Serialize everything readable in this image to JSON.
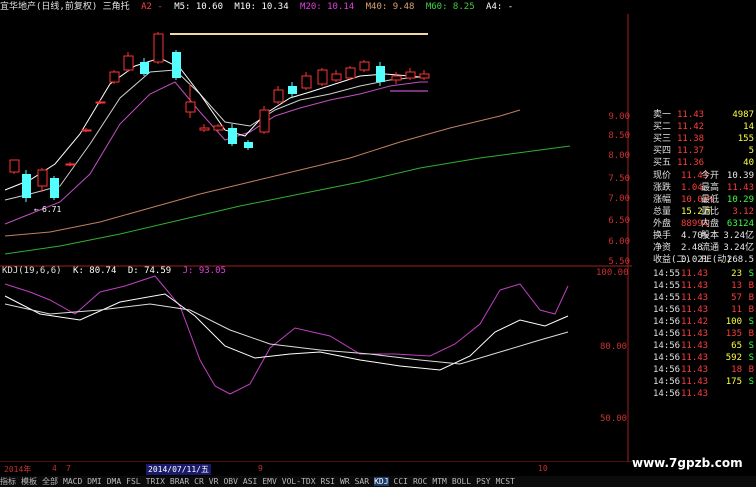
{
  "topbar": {
    "title": "宜华地产(日线,前复权) 三角托",
    "a2": "A2 -",
    "m5": "M5: 10.60",
    "m10": "M10: 10.34",
    "m20": "M20: 10.14",
    "m40": "M40: 9.48",
    "m60": "M60: 8.25",
    "a4": "A4: -"
  },
  "colors": {
    "bg": "#000000",
    "up": "#ff3232",
    "down": "#54ffff",
    "ma5": "#ffffff",
    "ma10": "#e0e0e0",
    "ma20": "#c050c0",
    "ma40": "#d08060",
    "ma60": "#30b030",
    "resist": "#f0d8a0",
    "price_red": "#ff3c3c",
    "price_green": "#3cff3c",
    "price_white": "#e8e8e8",
    "price_yellow": "#ffff40"
  },
  "price_axis": [
    "9.00",
    "8.50",
    "8.00",
    "7.50",
    "7.00",
    "6.50",
    "6.00",
    "5.50"
  ],
  "low_marker": "6.71",
  "kdj": {
    "title": "KDJ(19,6,6)",
    "k": "K: 80.74",
    "d": "D: 74.59",
    "j": "J: 93.05",
    "axis": [
      "100.00",
      "80.00",
      "50.00"
    ]
  },
  "date_axis": {
    "year": "2014年",
    "m4": "4",
    "m7": "7",
    "cursor_date": "2014/07/11/五",
    "m9": "9",
    "m10": "10"
  },
  "quote": {
    "asks": [
      {
        "label": "卖一",
        "price": "11.43",
        "vol": "4987"
      },
      {
        "label": "买二",
        "price": "11.42",
        "vol": "14"
      },
      {
        "label": "买三",
        "price": "11.38",
        "vol": "155"
      },
      {
        "label": "买四",
        "price": "11.37",
        "vol": "5"
      },
      {
        "label": "买五",
        "price": "11.36",
        "vol": "40"
      }
    ],
    "stats": [
      {
        "l1": "现价",
        "v1": "11.43",
        "l2": "今开",
        "v2": "10.39",
        "c1": "red",
        "c2": "white"
      },
      {
        "l1": "涨跌",
        "v1": "1.04",
        "l2": "最高",
        "v2": "11.43",
        "c1": "red",
        "c2": "red"
      },
      {
        "l1": "涨幅",
        "v1": "10.01%",
        "l2": "最低",
        "v2": "10.29",
        "c1": "red",
        "c2": "green"
      },
      {
        "l1": "总量",
        "v1": "15.2万",
        "l2": "量比",
        "v2": "3.12",
        "c1": "yellow",
        "c2": "red"
      },
      {
        "l1": "外盘",
        "v1": "88994",
        "l2": "内盘",
        "v2": "63124",
        "c1": "red",
        "c2": "green"
      },
      {
        "l1": "换手",
        "v1": "4.70%",
        "l2": "股本",
        "v2": "3.24亿",
        "c1": "white",
        "c2": "white"
      },
      {
        "l1": "净资",
        "v1": "2.48",
        "l2": "流通",
        "v2": "3.24亿",
        "c1": "white",
        "c2": "white"
      },
      {
        "l1": "收益(二)",
        "v1": "0.021",
        "l2": "PE(动)",
        "v2": "268.5",
        "c1": "white",
        "c2": "white"
      }
    ],
    "ticks": [
      {
        "time": "14:55",
        "price": "11.43",
        "vol": "23",
        "side": "S"
      },
      {
        "time": "14:55",
        "price": "11.43",
        "vol": "13",
        "side": "B"
      },
      {
        "time": "14:55",
        "price": "11.43",
        "vol": "57",
        "side": "B"
      },
      {
        "time": "14:56",
        "price": "11.43",
        "vol": "11",
        "side": "B"
      },
      {
        "time": "14:56",
        "price": "11.42",
        "vol": "100",
        "side": "S"
      },
      {
        "time": "14:56",
        "price": "11.43",
        "vol": "135",
        "side": "B"
      },
      {
        "time": "14:56",
        "price": "11.43",
        "vol": "65",
        "side": "S"
      },
      {
        "time": "14:56",
        "price": "11.43",
        "vol": "592",
        "side": "S"
      },
      {
        "time": "14:56",
        "price": "11.43",
        "vol": "18",
        "side": "B"
      },
      {
        "time": "14:56",
        "price": "11.43",
        "vol": "175",
        "side": "S"
      },
      {
        "time": "14:56",
        "price": "11.43",
        "vol": "",
        "side": ""
      }
    ]
  },
  "bottom_tabs": [
    "指标",
    "模板",
    "全部",
    "MACD",
    "DMI",
    "DMA",
    "FSL",
    "TRIX",
    "BRAR",
    "CR",
    "VR",
    "OBV",
    "ASI",
    "EMV",
    "VOL-TDX",
    "RSI",
    "WR",
    "SAR",
    "KDJ",
    "CCI",
    "ROC",
    "MTM",
    "BOLL",
    "PSY",
    "MCST"
  ],
  "watermark": "www.7gpzb.com"
}
